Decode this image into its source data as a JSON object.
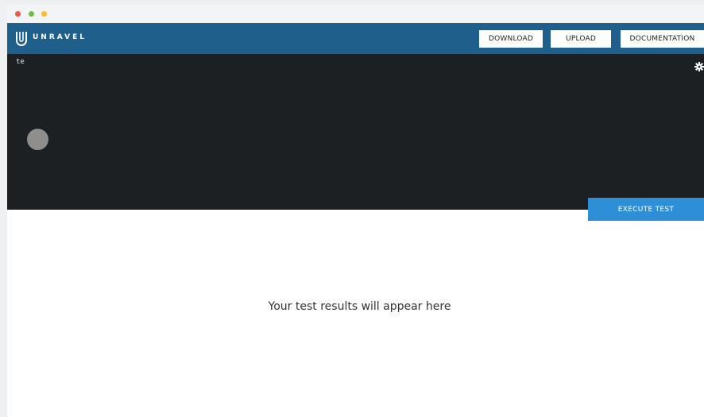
{
  "window": {
    "controls": [
      "close",
      "minimize",
      "maximize"
    ]
  },
  "header": {
    "brand": "UNRAVEL",
    "logo_icon": "unravel-logo-icon",
    "nav": {
      "download": "DOWNLOAD",
      "upload": "UPLOAD",
      "documentation": "DOCUMENTATION"
    },
    "background_color": "#1f5f8b"
  },
  "editor": {
    "content": "te",
    "settings_icon": "gear-icon",
    "background_color": "#1d2022"
  },
  "actions": {
    "execute": "EXECUTE TEST",
    "execute_color": "#2e8fd6"
  },
  "results": {
    "placeholder": "Your test results will appear here"
  }
}
